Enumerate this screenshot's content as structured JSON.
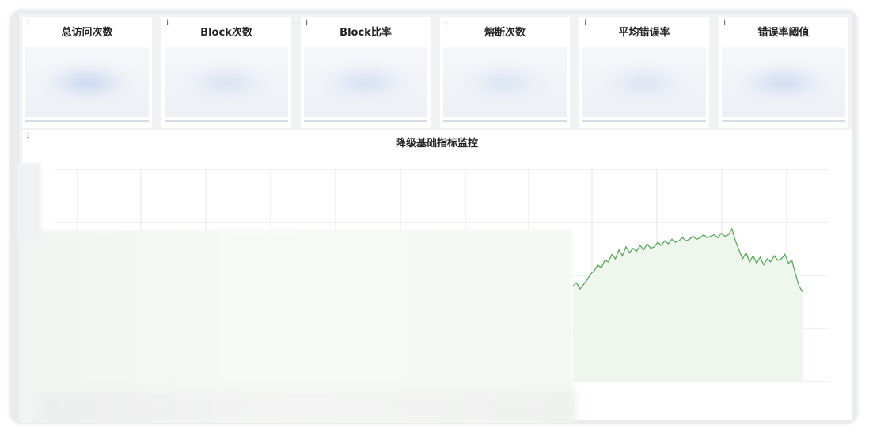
{
  "stat_cards": [
    {
      "title": "总访问次数",
      "info": "i"
    },
    {
      "title": "Block次数",
      "info": "i"
    },
    {
      "title": "Block比率",
      "info": "i"
    },
    {
      "title": "熔断次数",
      "info": "i"
    },
    {
      "title": "平均错误率",
      "info": "i"
    },
    {
      "title": "错误率阈值",
      "info": "i"
    }
  ],
  "panel": {
    "title": "降级基础指标监控",
    "info": "i"
  },
  "colors": {
    "line": "#5aa85a",
    "fill": "#eef6ee",
    "grid": "#e3e5e8"
  },
  "chart_data": {
    "type": "area",
    "title": "降级基础指标监控",
    "grid": true,
    "series": [
      {
        "values": [
          62,
          64,
          60,
          63,
          66,
          70,
          72,
          76,
          74,
          79,
          78,
          83,
          80,
          86,
          82,
          88,
          84,
          87,
          85,
          89,
          86,
          90,
          87,
          88,
          91,
          89,
          92,
          90,
          93,
          91,
          92,
          94,
          92,
          93,
          95,
          93,
          94,
          96,
          94,
          95,
          96,
          94,
          97,
          95,
          96,
          100,
          92,
          86,
          80,
          84,
          78,
          82,
          77,
          81,
          76,
          80,
          78,
          82,
          79,
          80,
          83,
          77,
          79,
          70,
          62,
          58
        ]
      }
    ]
  }
}
